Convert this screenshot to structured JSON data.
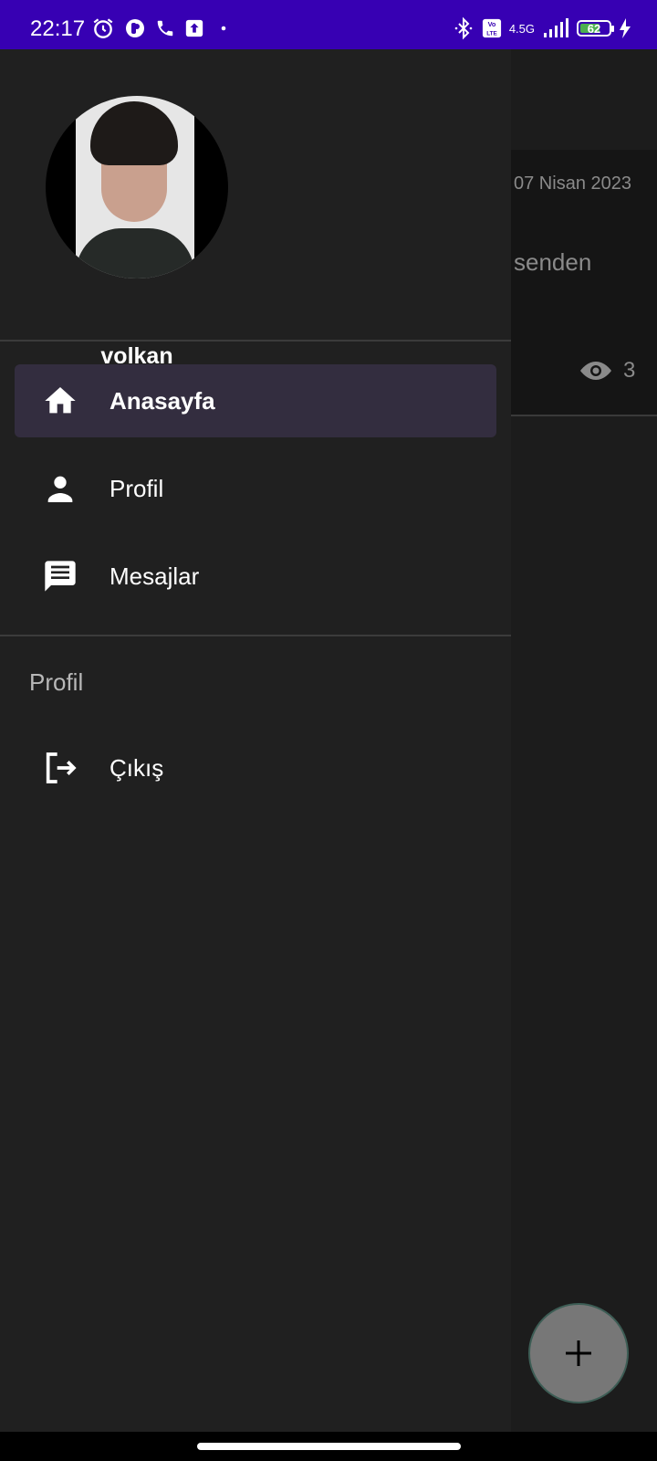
{
  "status_bar": {
    "time": "22:17",
    "network": "4.5G",
    "battery": "62",
    "icons": [
      "alarm-icon",
      "app-icon",
      "phone-icon",
      "upload-icon",
      "dot-icon",
      "bluetooth-icon",
      "volte-icon",
      "signal-icon",
      "battery-icon",
      "charging-icon"
    ]
  },
  "background_app": {
    "date": "07 Nisan 2023",
    "text": "senden",
    "views": "3",
    "fab_label": "+"
  },
  "drawer": {
    "username": "volkan",
    "nav_items": [
      {
        "label": "Anasayfa",
        "icon": "home-icon",
        "active": true
      },
      {
        "label": "Profil",
        "icon": "person-icon",
        "active": false
      },
      {
        "label": "Mesajlar",
        "icon": "message-icon",
        "active": false
      }
    ],
    "section_title": "Profil",
    "section_items": [
      {
        "label": "Çıkış",
        "icon": "logout-icon"
      }
    ]
  },
  "colors": {
    "status_bar": "#3700b3",
    "drawer_bg": "#202020",
    "active_item_bg": "#332d3f",
    "battery_fill": "#4caf50"
  }
}
